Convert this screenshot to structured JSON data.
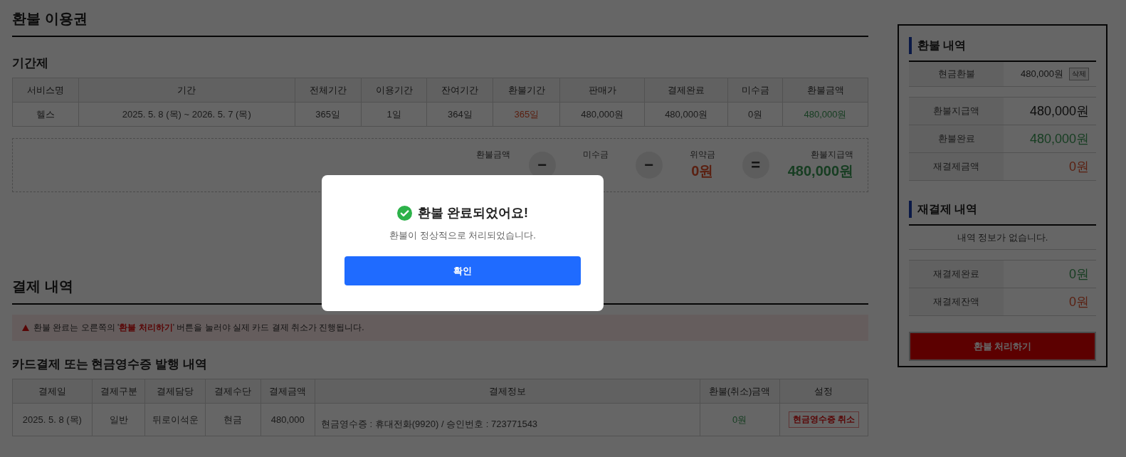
{
  "page_title": "환불 이용권",
  "period_section": {
    "title": "기간제",
    "columns": [
      "서비스명",
      "기간",
      "전체기간",
      "이용기간",
      "잔여기간",
      "환불기간",
      "판매가",
      "결제완료",
      "미수금",
      "환불금액"
    ],
    "rows": [
      [
        {
          "text": "헬스",
          "negative": false,
          "positive": false
        },
        {
          "text": "2025. 5. 8 (목) ~ 2026. 5. 7 (목)",
          "negative": false,
          "positive": false
        },
        {
          "text": "365일",
          "negative": false,
          "positive": false
        },
        {
          "text": "1일",
          "negative": false,
          "positive": false
        },
        {
          "text": "364일",
          "negative": false,
          "positive": false
        },
        {
          "text": "365일",
          "negative": true,
          "positive": false
        },
        {
          "text": "480,000원",
          "negative": false,
          "positive": false
        },
        {
          "text": "480,000원",
          "negative": false,
          "positive": false
        },
        {
          "text": "0원",
          "negative": false,
          "positive": false
        },
        {
          "text": "480,000원",
          "negative": false,
          "positive": true
        }
      ]
    ]
  },
  "summary": [
    {
      "kind": "amount",
      "label": "환불금액"
    },
    {
      "kind": "operator",
      "symbol": "−"
    },
    {
      "kind": "amount",
      "label": "미수금"
    },
    {
      "kind": "operator",
      "symbol": "−"
    },
    {
      "kind": "amount",
      "label": "위약금",
      "value": "0원",
      "negative": true,
      "positive": false
    },
    {
      "kind": "operator",
      "symbol": "="
    },
    {
      "kind": "amount",
      "label": "환불지급액",
      "value": "480,000원",
      "negative": false,
      "positive": true
    }
  ],
  "payment_section": {
    "title": "결제 내역",
    "notice": "환불 완료는 오른쪽의 '**환불 처리하기**' 버튼을 눌러야 실제 카드 결제 취소가 진행됩니다.",
    "receipts": {
      "title": "카드결제 또는 현금영수증 발행 내역",
      "columns": [
        "결제일",
        "결제구분",
        "결제담당",
        "결제수단",
        "결제금액",
        "결제정보",
        "환불(취소)금액",
        "설정"
      ],
      "rows": [
        [
          {
            "text": "2025. 5. 8 (목)",
            "negative": false,
            "positive": false
          },
          {
            "text": "일반",
            "negative": false,
            "positive": false
          },
          {
            "text": "뒤로이석운",
            "negative": false,
            "positive": false
          },
          {
            "text": "현금",
            "negative": false,
            "positive": false
          },
          {
            "text": "480,000",
            "negative": false,
            "positive": false
          },
          {
            "text": "현금영수증 : 휴대전화(9920) / 승인번호 : 723771543",
            "negative": false,
            "positive": false
          },
          {
            "text": "0원",
            "negative": false,
            "positive": true
          },
          {
            "text": "현금영수증 취소",
            "kind": "button"
          }
        ]
      ]
    }
  },
  "side_panel": {
    "refund_title": "환불 내역",
    "refund_items": [
      {
        "label": "현금환불",
        "value": "480,000원",
        "action": "삭제"
      }
    ],
    "refund_totals": [
      {
        "label": "환불지급액",
        "value": "480,000원",
        "negative": false,
        "positive": false
      },
      {
        "label": "환불완료",
        "value": "480,000원",
        "negative": false,
        "positive": true
      },
      {
        "label": "재결제금액",
        "value": "0원",
        "negative": true,
        "positive": false
      }
    ],
    "rebill_title": "재결제 내역",
    "rebill_empty": "내역 정보가 없습니다.",
    "rebill_totals": [
      {
        "label": "재결제완료",
        "value": "0원",
        "negative": false,
        "positive": true
      },
      {
        "label": "재결제잔액",
        "value": "0원",
        "negative": true,
        "positive": false
      }
    ],
    "process_button": "환불 처리하기"
  },
  "modal": {
    "title": "환불 완료되었어요!",
    "message": "환불이 정상적으로 처리되었습니다.",
    "confirm": "확인"
  }
}
